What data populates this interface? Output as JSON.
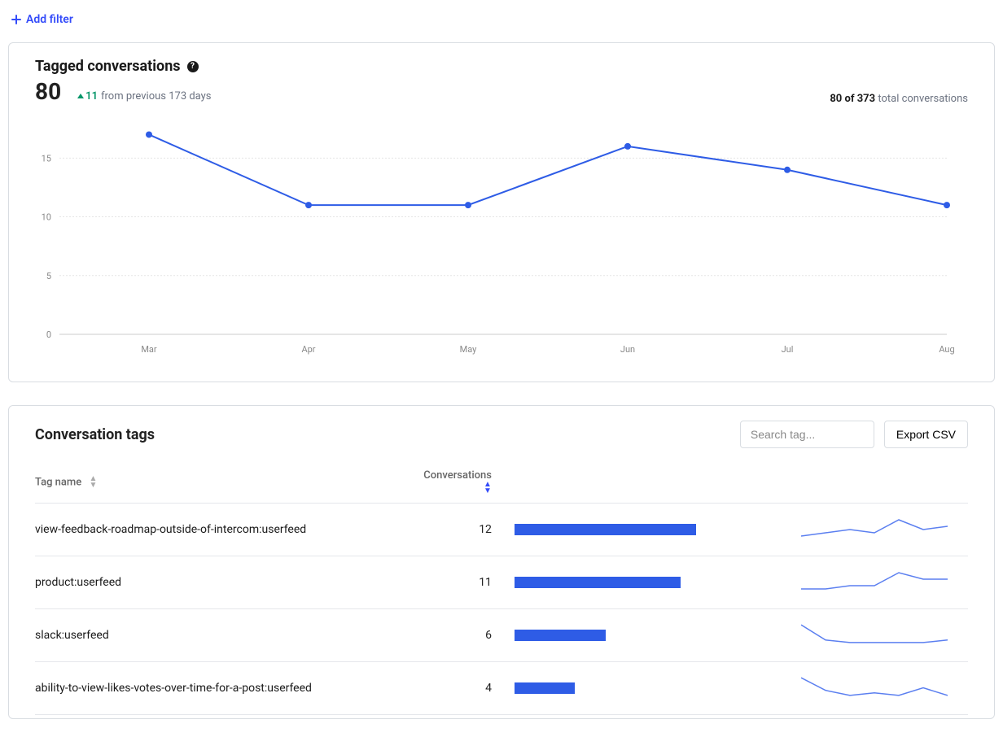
{
  "filter": {
    "add_label": "Add filter"
  },
  "card": {
    "title": "Tagged conversations",
    "metric_value": "80",
    "delta_value": "11",
    "delta_suffix": "from previous 173 days",
    "right_count": "80 of 373",
    "right_suffix": "total conversations"
  },
  "chart_data": {
    "type": "line",
    "categories": [
      "Mar",
      "Apr",
      "May",
      "Jun",
      "Jul",
      "Aug"
    ],
    "values": [
      17,
      11,
      11,
      16,
      14,
      11
    ],
    "ylabel": "",
    "xlabel": "",
    "ylim": [
      0,
      18
    ],
    "yticks": [
      0,
      5,
      10,
      15
    ],
    "title": "Tagged conversations"
  },
  "tags": {
    "title": "Conversation tags",
    "search_placeholder": "Search tag...",
    "export_label": "Export CSV",
    "col_name": "Tag name",
    "col_convs": "Conversations",
    "bar_max": 12,
    "rows": [
      {
        "name": "view-feedback-roadmap-outside-of-intercom:userfeed",
        "count": 12,
        "spark": [
          10,
          11,
          12,
          11,
          15,
          12,
          13
        ]
      },
      {
        "name": "product:userfeed",
        "count": 11,
        "spark": [
          9,
          9,
          10,
          10,
          14,
          12,
          12
        ]
      },
      {
        "name": "slack:userfeed",
        "count": 6,
        "spark": [
          14,
          8,
          7,
          7,
          7,
          7,
          8
        ]
      },
      {
        "name": "ability-to-view-likes-votes-over-time-for-a-post:userfeed",
        "count": 4,
        "spark": [
          13,
          8,
          6,
          7,
          6,
          9,
          6
        ]
      }
    ]
  }
}
